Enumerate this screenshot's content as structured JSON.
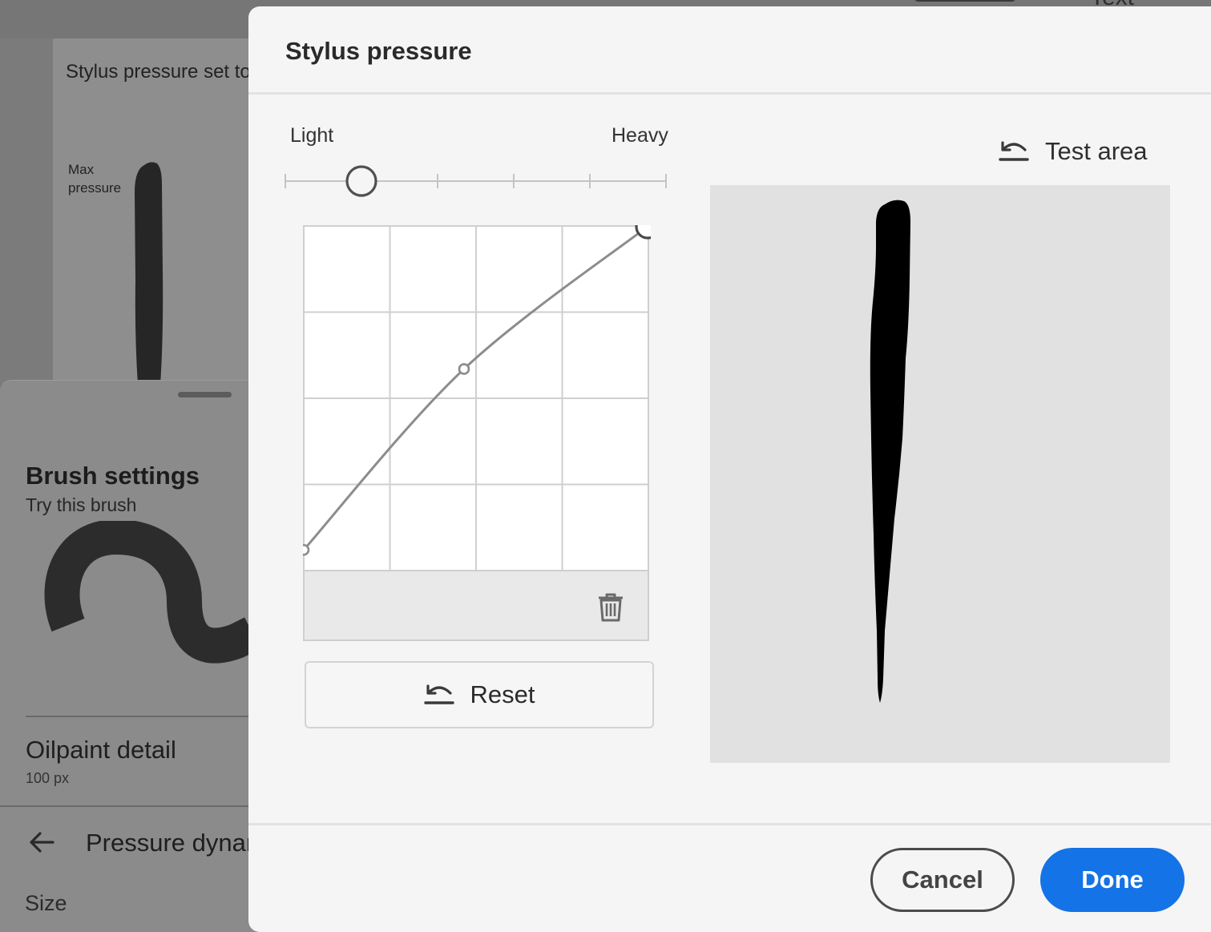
{
  "background": {
    "top_text": "Text",
    "card": {
      "title": "Stylus pressure set to",
      "max_label_1": "Max",
      "max_label_2": "pressure"
    },
    "panel": {
      "title": "Brush settings",
      "subtitle": "Try this brush",
      "brush_name": "Oilpaint detail",
      "brush_size": "100 px",
      "section": "Pressure dynamics",
      "size_label": "Size"
    }
  },
  "dialog": {
    "title": "Stylus pressure",
    "slider": {
      "label_min": "Light",
      "label_max": "Heavy",
      "steps": 5,
      "value_step": 1
    },
    "curve": {
      "grid_divisions": 4,
      "points": [
        [
          0,
          0.06
        ],
        [
          0.465,
          0.585
        ],
        [
          1,
          1
        ]
      ]
    },
    "reset_label": "Reset",
    "test_area_label": "Test area",
    "cancel_label": "Cancel",
    "done_label": "Done"
  },
  "colors": {
    "accent": "#1473e6",
    "curve": "#8c8c8c",
    "dialog_bg": "#f5f5f5",
    "test_area_bg": "#e1e1e1"
  },
  "icons": {
    "undo": "undo-icon",
    "trash": "trash-icon",
    "back": "arrow-left-icon"
  }
}
